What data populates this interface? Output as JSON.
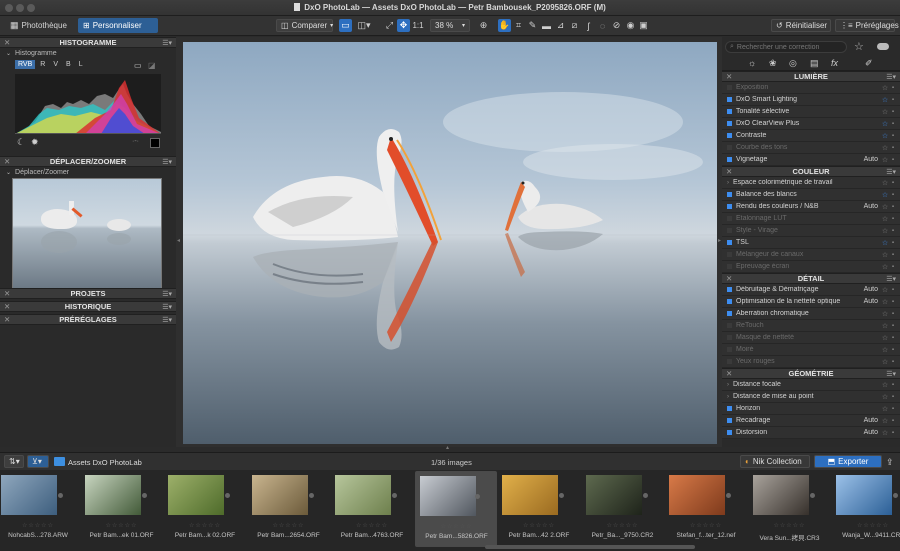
{
  "window": {
    "title": "DxO PhotoLab — Assets DxO PhotoLab — Petr Bambousek_P2095826.ORF (M)"
  },
  "toolbar": {
    "tab_library": "Photothèque",
    "tab_customize": "Personnaliser",
    "compare": "Comparer",
    "zoom_1to1": "1:1",
    "zoom_value": "38 %",
    "reset": "Réinitialiser",
    "presets": "Préréglages"
  },
  "left_panel": {
    "histogram": {
      "title": "HISTOGRAMME",
      "sub": "Histogramme",
      "channels": [
        "RVB",
        "R",
        "V",
        "B",
        "L"
      ]
    },
    "move_zoom": {
      "title": "DÉPLACER/ZOOMER",
      "sub": "Déplacer/Zoomer"
    },
    "projects": "PROJETS",
    "history": "HISTORIQUE",
    "presets": "PRÉRÉGLAGES"
  },
  "right_panel": {
    "search_placeholder": "Rechercher une correction",
    "sections": [
      {
        "title": "LUMIÈRE",
        "items": [
          {
            "label": "Exposition",
            "active": false,
            "auto": "",
            "fav": false
          },
          {
            "label": "DxO Smart Lighting",
            "active": true,
            "auto": "",
            "fav": true
          },
          {
            "label": "Tonalité sélective",
            "active": true,
            "auto": "",
            "fav": false
          },
          {
            "label": "DxO ClearView Plus",
            "active": true,
            "auto": "",
            "fav": true
          },
          {
            "label": "Contraste",
            "active": true,
            "auto": "",
            "fav": true
          },
          {
            "label": "Courbe des tons",
            "active": false,
            "auto": "",
            "fav": false
          },
          {
            "label": "Vignetage",
            "active": true,
            "auto": "Auto",
            "fav": false
          }
        ]
      },
      {
        "title": "COULEUR",
        "items": [
          {
            "label": "Espace colorimétrique de travail",
            "active": true,
            "auto": "",
            "fav": false,
            "arrow": true
          },
          {
            "label": "Balance des blancs",
            "active": true,
            "auto": "",
            "fav": true
          },
          {
            "label": "Rendu des couleurs / N&B",
            "active": true,
            "auto": "Auto",
            "fav": false
          },
          {
            "label": "Étalonnage LUT",
            "active": false,
            "auto": "",
            "fav": false
          },
          {
            "label": "Style - Virage",
            "active": false,
            "auto": "",
            "fav": false
          },
          {
            "label": "TSL",
            "active": true,
            "auto": "",
            "fav": true
          },
          {
            "label": "Mélangeur de canaux",
            "active": false,
            "auto": "",
            "fav": false
          },
          {
            "label": "Épreuvage écran",
            "active": false,
            "auto": "",
            "fav": false
          }
        ]
      },
      {
        "title": "DÉTAIL",
        "items": [
          {
            "label": "Débruitage & Dématriçage",
            "active": true,
            "auto": "Auto",
            "fav": false
          },
          {
            "label": "Optimisation de la netteté optique",
            "active": true,
            "auto": "Auto",
            "fav": false
          },
          {
            "label": "Aberration chromatique",
            "active": true,
            "auto": "",
            "fav": false
          },
          {
            "label": "ReTouch",
            "active": false,
            "auto": "",
            "fav": false
          },
          {
            "label": "Masque de netteté",
            "active": false,
            "auto": "",
            "fav": false
          },
          {
            "label": "Moiré",
            "active": false,
            "auto": "",
            "fav": false
          },
          {
            "label": "Yeux rouges",
            "active": false,
            "auto": "",
            "fav": false
          }
        ]
      },
      {
        "title": "GÉOMÉTRIE",
        "items": [
          {
            "label": "Distance focale",
            "active": true,
            "auto": "",
            "fav": false,
            "arrow": true
          },
          {
            "label": "Distance de mise au point",
            "active": true,
            "auto": "",
            "fav": false,
            "arrow": true
          },
          {
            "label": "Horizon",
            "active": true,
            "auto": "",
            "fav": false
          },
          {
            "label": "Recadrage",
            "active": true,
            "auto": "Auto",
            "fav": false
          },
          {
            "label": "Distorsion",
            "active": true,
            "auto": "Auto",
            "fav": false
          }
        ]
      }
    ]
  },
  "filmstrip": {
    "folder": "Assets DxO PhotoLab",
    "count": "1/36 images",
    "nik": "Nik Collection",
    "export": "Exporter",
    "thumbs": [
      {
        "name": "NohcabS...278.ARW",
        "c1": "#8fa7bd",
        "c2": "#3d5e7e"
      },
      {
        "name": "Petr Bam...ek 01.ORF",
        "c1": "#c8d5c0",
        "c2": "#425a38"
      },
      {
        "name": "Petr Bam...k 02.ORF",
        "c1": "#9db06a",
        "c2": "#4e6b2a"
      },
      {
        "name": "Petr Bam...2654.ORF",
        "c1": "#c9b58f",
        "c2": "#6b5a3a"
      },
      {
        "name": "Petr Bam...4763.ORF",
        "c1": "#b7c69c",
        "c2": "#6d7f4c"
      },
      {
        "name": "Petr Bam...5826.ORF",
        "c1": "#c8ccd2",
        "c2": "#50565e"
      },
      {
        "name": "Petr Bam...42 2.ORF",
        "c1": "#e1b04a",
        "c2": "#9a6a20"
      },
      {
        "name": "Petr_Ba..._9750.CR2",
        "c1": "#5e6a4f",
        "c2": "#1e231a"
      },
      {
        "name": "Stefan_f...ter_12.nef",
        "c1": "#d87a48",
        "c2": "#7e3a1c"
      },
      {
        "name": "Vera Sun...拷貝.CR3",
        "c1": "#a9a39c",
        "c2": "#36302b"
      },
      {
        "name": "Wanja_W...9411.CR3",
        "c1": "#9cc1e8",
        "c2": "#2b5f96"
      }
    ]
  }
}
